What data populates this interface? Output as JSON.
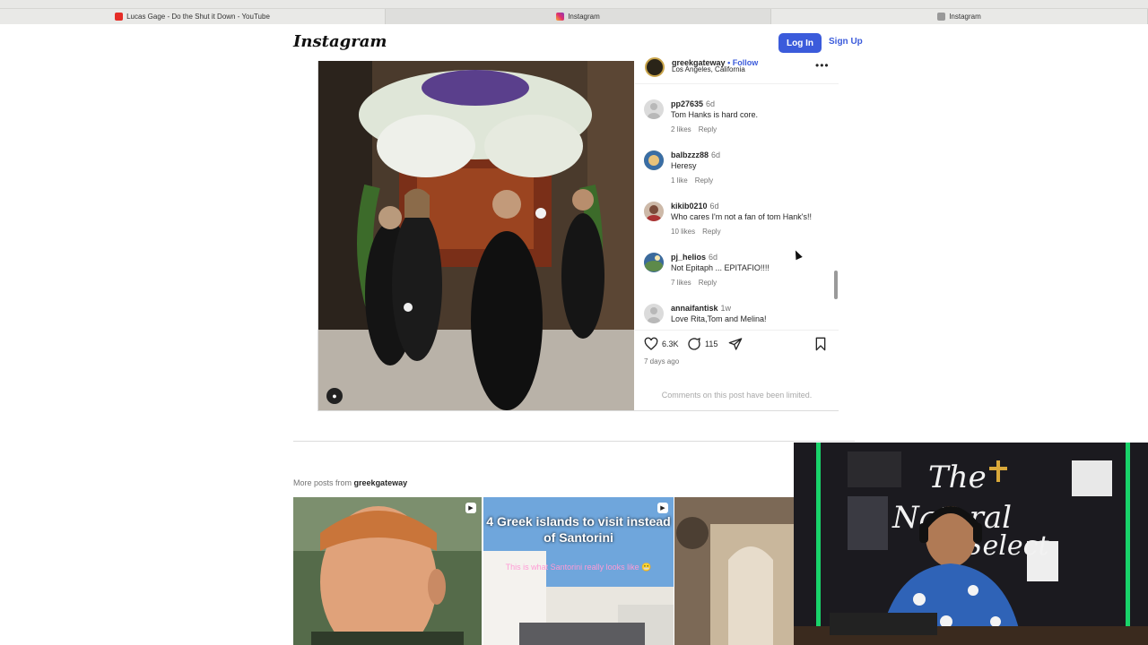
{
  "browser": {
    "tabs": [
      {
        "title": "Lucas Gage - Do the Shut it Down - YouTube",
        "icon": "youtube-icon"
      },
      {
        "title": "Instagram",
        "icon": "instagram-icon"
      },
      {
        "title": "Instagram",
        "icon": "page-icon"
      }
    ],
    "active_tab_index": 1
  },
  "header": {
    "logo": "Instagram",
    "login_label": "Log In",
    "signup_label": "Sign Up"
  },
  "post": {
    "author": "greekgateway",
    "follow_label": "• Follow",
    "location": "Los Angeles, California",
    "more_icon": "more-options-icon",
    "comments": [
      {
        "user": "pp27635",
        "time": "6d",
        "text": "Tom Hanks is hard core.",
        "likes": "2 likes",
        "reply": "Reply"
      },
      {
        "user": "balbzzz88",
        "time": "6d",
        "text": "Heresy",
        "likes": "1 like",
        "reply": "Reply"
      },
      {
        "user": "kikib0210",
        "time": "6d",
        "text": "Who cares I'm not a fan of tom Hank's!!",
        "likes": "10 likes",
        "reply": "Reply"
      },
      {
        "user": "pj_helios",
        "time": "6d",
        "text": "Not Epitaph ... EPITAFIO!!!!",
        "likes": "7 likes",
        "reply": "Reply"
      },
      {
        "user": "annaifantisk",
        "time": "1w",
        "text": "Love Rita,Tom and Melina!",
        "likes": "",
        "reply": ""
      }
    ],
    "like_count": "6.3K",
    "comment_count": "115",
    "posted_ago": "7 days ago",
    "comments_limited": "Comments on this post have been limited."
  },
  "more_posts": {
    "prefix": "More posts from",
    "author": "greekgateway",
    "items": [
      {
        "title": "",
        "subtitle": ""
      },
      {
        "title": "4 Greek islands to visit instead of Santorini",
        "subtitle": "This is what Santorini really looks like 😬"
      },
      {
        "title": "",
        "subtitle": ""
      }
    ]
  },
  "colors": {
    "accent": "#3b5bdb",
    "text": "#262626",
    "muted": "#737373",
    "border": "#dbdbdb"
  }
}
